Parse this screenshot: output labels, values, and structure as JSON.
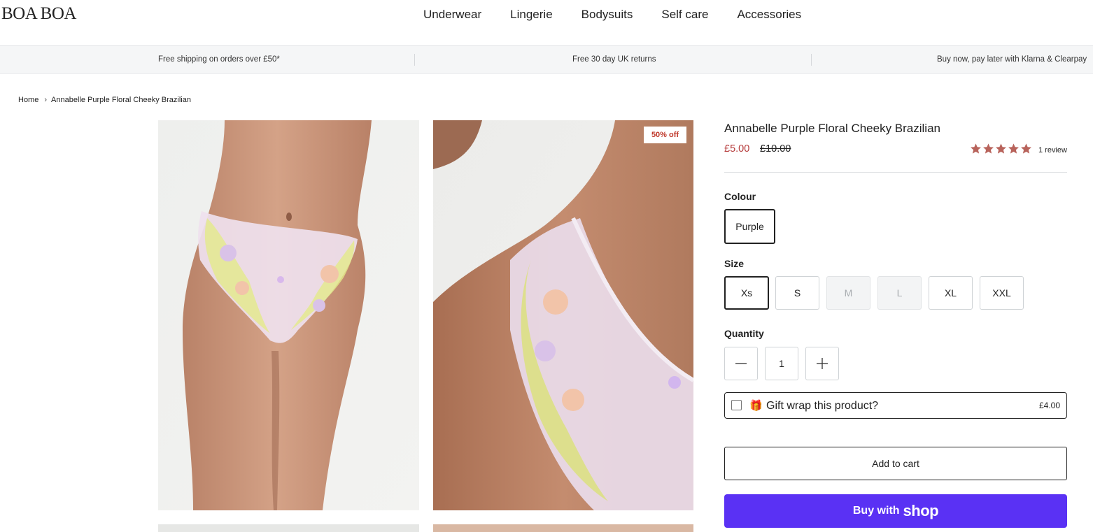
{
  "brand": {
    "logo_text": "BOA BOA"
  },
  "nav": {
    "items": [
      "Underwear",
      "Lingerie",
      "Bodysuits",
      "Self care",
      "Accessories"
    ]
  },
  "infobar": {
    "shipping": "Free shipping on orders over £50*",
    "returns": "Free 30 day UK returns",
    "paylater": "Buy now, pay later with Klarna & Clearpay"
  },
  "breadcrumb": {
    "home": "Home",
    "current": "Annabelle Purple Floral Cheeky Brazilian"
  },
  "gallery": {
    "badge": "50% off"
  },
  "product": {
    "title": "Annabelle Purple Floral Cheeky Brazilian",
    "price_now": "£5.00",
    "price_was": "£10.00",
    "rating": 5,
    "review_count": "1 review",
    "colour_label": "Colour",
    "colour_options": [
      {
        "label": "Purple",
        "selected": true
      }
    ],
    "size_label": "Size",
    "size_options": [
      {
        "label": "Xs",
        "selected": true,
        "available": true
      },
      {
        "label": "S",
        "selected": false,
        "available": true
      },
      {
        "label": "M",
        "selected": false,
        "available": false
      },
      {
        "label": "L",
        "selected": false,
        "available": false
      },
      {
        "label": "XL",
        "selected": false,
        "available": true
      },
      {
        "label": "XXL",
        "selected": false,
        "available": true
      }
    ],
    "quantity_label": "Quantity",
    "quantity": "1",
    "gift": {
      "icon": "🎁",
      "label": "Gift wrap this product?",
      "price": "£4.00"
    },
    "add_to_cart": "Add to cart",
    "buy_with": "Buy with",
    "buy_brand": "shop"
  },
  "colors": {
    "sale_red": "#b53a3a",
    "star": "#b8635b",
    "shop_purple": "#5a31f4",
    "border": "#cfd3d6"
  }
}
